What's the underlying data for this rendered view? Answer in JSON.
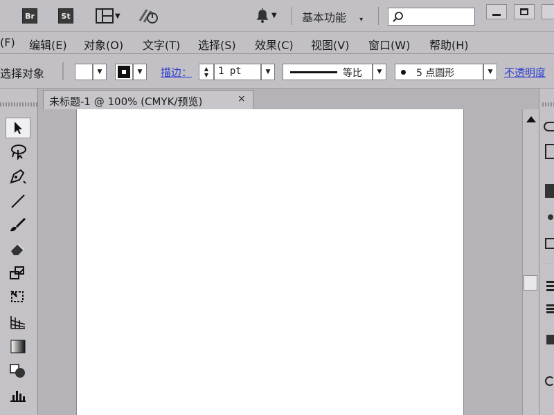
{
  "appbar": {
    "bridge_label": "Br",
    "stock_label": "St",
    "workspace_label": "基本功能",
    "search": {
      "value": "",
      "placeholder": ""
    }
  },
  "menu": {
    "items": [
      "(F)",
      "编辑(E)",
      "对象(O)",
      "文字(T)",
      "选择(S)",
      "效果(C)",
      "视图(V)",
      "窗口(W)",
      "帮助(H)"
    ]
  },
  "control": {
    "no_selection": "选择对象",
    "stroke_label": "描边：",
    "stroke_value": "1 pt",
    "profile_label": "等比",
    "brush_label": "5 点圆形",
    "opacity_label": "不透明度"
  },
  "document": {
    "tab_title": "未标题-1 @ 100% (CMYK/预览)",
    "close_glyph": "×"
  },
  "colors": {
    "chrome": "#c2c0c4",
    "canvas": "#b5b3b7",
    "artboard": "#ffffff",
    "link": "#2a3ccf"
  }
}
